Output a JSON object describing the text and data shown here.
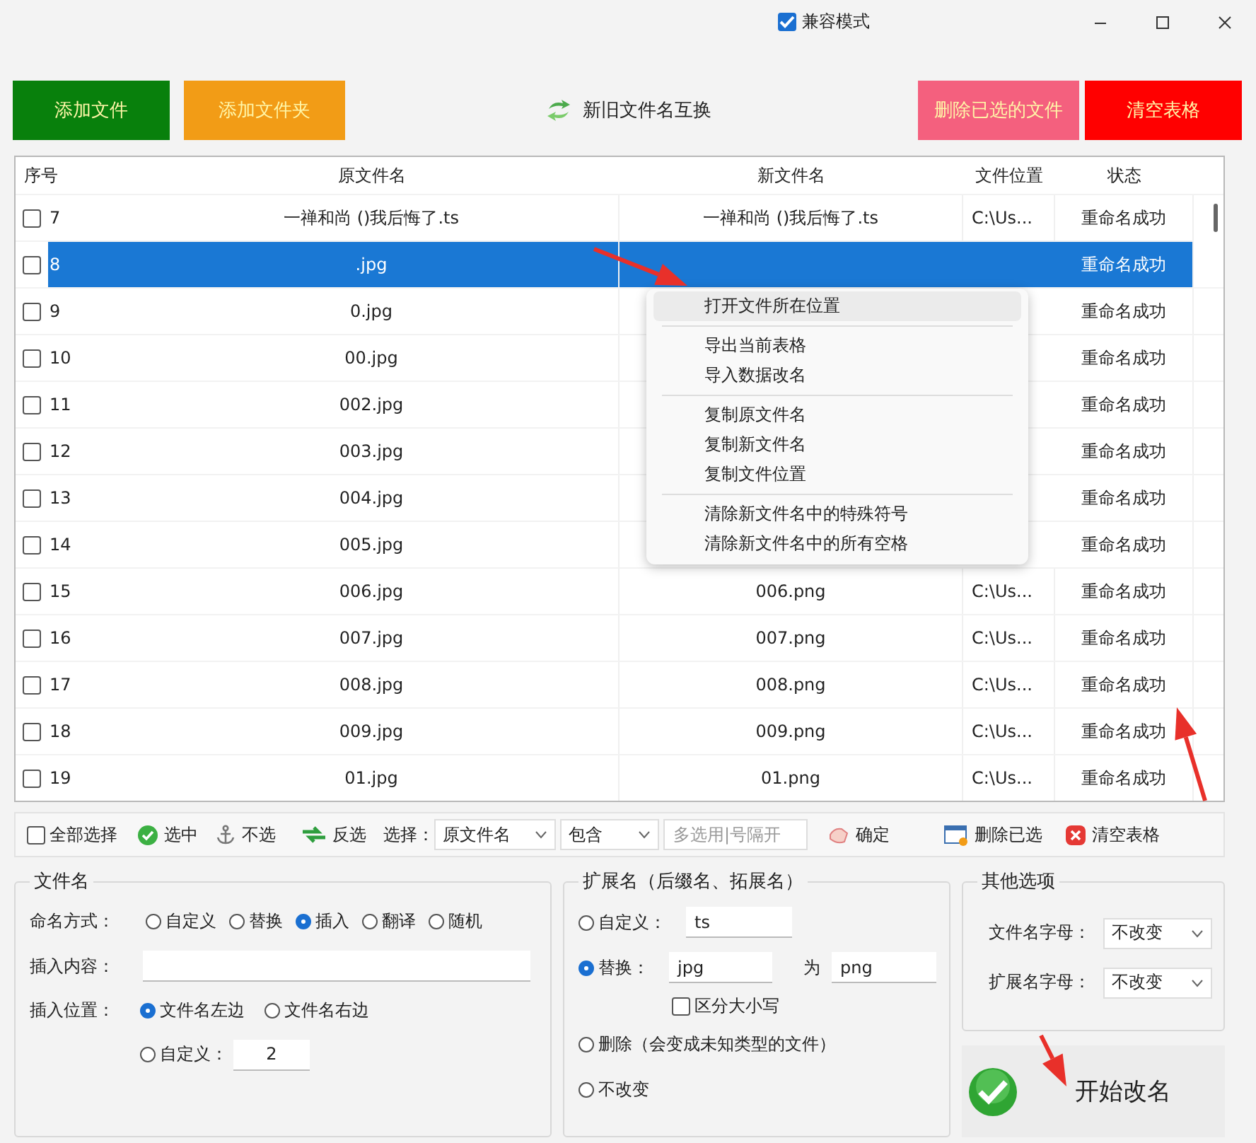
{
  "window": {
    "compat_mode": {
      "label": "兼容模式",
      "checked": true
    }
  },
  "toolbar": [
    {
      "label": "添加文件",
      "kind": "colored",
      "color": "#08800c"
    },
    {
      "label": "添加文件夹",
      "kind": "colored",
      "color": "#f29c16"
    },
    {
      "label": "新旧文件名互换",
      "kind": "plain"
    },
    {
      "label": "删除已选的文件",
      "kind": "colored",
      "color": "#f4607e"
    },
    {
      "label": "清空表格",
      "kind": "colored",
      "color": "#ff0000"
    }
  ],
  "table": {
    "columns": [
      "序号",
      "原文件名",
      "新文件名",
      "文件位置",
      "状态"
    ],
    "rows": [
      {
        "no": "7",
        "checked": false,
        "selected": false,
        "original": "一禅和尚 ()我后悔了.ts",
        "new_name": "一禅和尚 ()我后悔了.ts",
        "location": "C:\\Us...",
        "status": "重命名成功"
      },
      {
        "no": "8",
        "checked": false,
        "selected": true,
        "original": ".jpg",
        "status": "重命名成功"
      },
      {
        "no": "9",
        "checked": false,
        "selected": false,
        "original": "0.jpg",
        "status": "重命名成功"
      },
      {
        "no": "10",
        "checked": false,
        "selected": false,
        "original": "00.jpg",
        "status": "重命名成功"
      },
      {
        "no": "11",
        "checked": false,
        "selected": false,
        "original": "002.jpg",
        "status": "重命名成功"
      },
      {
        "no": "12",
        "checked": false,
        "selected": false,
        "original": "003.jpg",
        "status": "重命名成功"
      },
      {
        "no": "13",
        "checked": false,
        "selected": false,
        "original": "004.jpg",
        "status": "重命名成功"
      },
      {
        "no": "14",
        "checked": false,
        "selected": false,
        "original": "005.jpg",
        "status": "重命名成功"
      },
      {
        "no": "15",
        "checked": false,
        "selected": false,
        "original": "006.jpg",
        "new_name": "006.png",
        "location": "C:\\Us...",
        "status": "重命名成功"
      },
      {
        "no": "16",
        "checked": false,
        "selected": false,
        "original": "007.jpg",
        "new_name": "007.png",
        "location": "C:\\Us...",
        "status": "重命名成功"
      },
      {
        "no": "17",
        "checked": false,
        "selected": false,
        "original": "008.jpg",
        "new_name": "008.png",
        "location": "C:\\Us...",
        "status": "重命名成功"
      },
      {
        "no": "18",
        "checked": false,
        "selected": false,
        "original": "009.jpg",
        "new_name": "009.png",
        "location": "C:\\Us...",
        "status": "重命名成功"
      },
      {
        "no": "19",
        "checked": false,
        "selected": false,
        "original": "01.jpg",
        "new_name": "01.png",
        "location": "C:\\Us...",
        "status": "重命名成功"
      }
    ]
  },
  "context_menu": {
    "groups": [
      [
        {
          "label": "打开文件所在位置",
          "highlighted": true
        }
      ],
      [
        {
          "label": "导出当前表格",
          "highlighted": false
        },
        {
          "label": "导入数据改名",
          "highlighted": false
        }
      ],
      [
        {
          "label": "复制原文件名",
          "highlighted": false
        },
        {
          "label": "复制新文件名",
          "highlighted": false
        },
        {
          "label": "复制文件位置",
          "highlighted": false
        }
      ],
      [
        {
          "label": "清除新文件名中的特殊符号",
          "highlighted": false
        },
        {
          "label": "清除新文件名中的所有空格",
          "highlighted": false
        }
      ]
    ]
  },
  "select_bar": {
    "select_all": {
      "label": "全部选择",
      "checked": false
    },
    "actions": [
      {
        "label": "选中",
        "kind": "check"
      },
      {
        "label": "不选",
        "kind": "anchor"
      },
      {
        "label": "反选",
        "kind": "swap"
      }
    ],
    "filter_label": "选择：",
    "field_select": "原文件名",
    "match_select": "包含",
    "placeholder": "多选用|号隔开",
    "confirm": "确定",
    "delete_selected": "删除已选",
    "clear_table": "清空表格"
  },
  "name_panel": {
    "title": "文件名",
    "method_label": "命名方式：",
    "methods": [
      {
        "label": "自定义",
        "selected": false
      },
      {
        "label": "替换",
        "selected": false
      },
      {
        "label": "插入",
        "selected": true
      },
      {
        "label": "翻译",
        "selected": false
      },
      {
        "label": "随机",
        "selected": false
      }
    ],
    "content_label": "插入内容：",
    "position_label": "插入位置：",
    "positions": [
      {
        "label": "文件名左边",
        "selected": true
      },
      {
        "label": "文件名右边",
        "selected": false
      },
      {
        "label": "自定义：",
        "selected": false
      }
    ],
    "custom_value": "2"
  },
  "ext_panel": {
    "title": "扩展名（后缀名、拓展名）",
    "options": [
      {
        "kind": "custom",
        "label": "自定义：",
        "selected": false,
        "value": "ts"
      },
      {
        "kind": "replace",
        "label": "替换：",
        "selected": true,
        "from": "jpg",
        "joiner": "为",
        "to": "png",
        "case": {
          "label": "区分大小写",
          "checked": false
        }
      },
      {
        "kind": "plain",
        "label": "删除（会变成未知类型的文件）",
        "selected": false
      },
      {
        "kind": "plain",
        "label": "不改变",
        "selected": false
      }
    ]
  },
  "other_panel": {
    "title": "其他选项",
    "rows": [
      {
        "label": "文件名字母：",
        "value": "不改变"
      },
      {
        "label": "扩展名字母：",
        "value": "不改变"
      }
    ]
  },
  "start_button": {
    "label": "开始改名"
  }
}
